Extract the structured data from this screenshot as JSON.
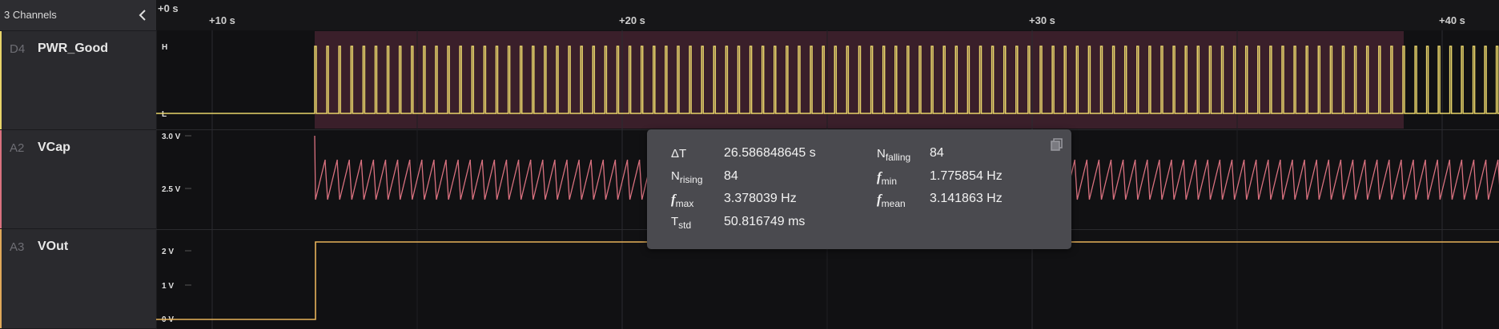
{
  "sidebar": {
    "title": "3 Channels",
    "channels": [
      {
        "id": "D4",
        "name": "PWR_Good",
        "color": "#e8d46a"
      },
      {
        "id": "A2",
        "name": "VCap",
        "color": "#d9717f"
      },
      {
        "id": "A3",
        "name": "VOut",
        "color": "#e0a85a"
      }
    ]
  },
  "timeline": {
    "labels": [
      "+0 s",
      "+10 s",
      "+20 s",
      "+30 s",
      "+40 s"
    ]
  },
  "levels": {
    "digital_high": "H",
    "digital_low": "L",
    "vcap_top": "3.0 V",
    "vcap_mid": "2.5 V",
    "vout_2": "2 V",
    "vout_1": "1 V",
    "vout_0": "0 V"
  },
  "measurement": {
    "delta_t_label": "ΔT",
    "delta_t": "26.586848645 s",
    "n_rising_label": "N",
    "n_rising_sub": "rising",
    "n_rising": "84",
    "f_max_label": "f",
    "f_max_sub": "max",
    "f_max": "3.378039 Hz",
    "t_std_label": "T",
    "t_std_sub": "std",
    "t_std": "50.816749 ms",
    "n_falling_label": "N",
    "n_falling_sub": "falling",
    "n_falling": "84",
    "f_min_label": "f",
    "f_min_sub": "min",
    "f_min": "1.775854 Hz",
    "f_mean_label": "f",
    "f_mean_sub": "mean",
    "f_mean": "3.141863 Hz"
  },
  "colors": {
    "background": "#111113",
    "selection": "#3a1f2a",
    "digital": "#e8d46a",
    "vcap": "#d9717f",
    "vout": "#e8b25a"
  }
}
